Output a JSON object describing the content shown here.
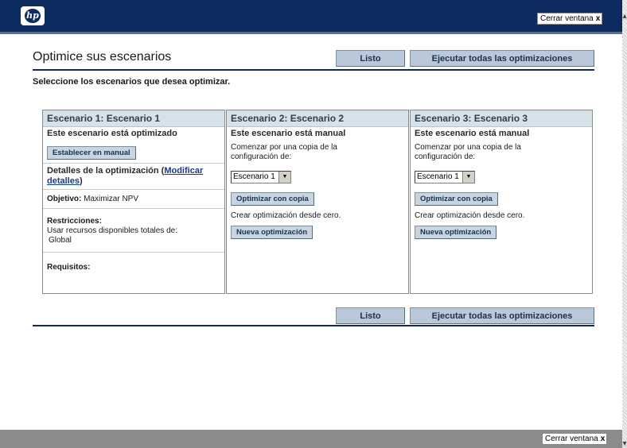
{
  "header": {
    "logo_text": "hp",
    "close_label": "Cerrar ventana",
    "close_icon": "x"
  },
  "page": {
    "title": "Optimice sus escenarios",
    "instruction": "Seleccione los escenarios que desea optimizar.",
    "done_label": "Listo",
    "run_all_label": "Ejecutar todas las optimizaciones"
  },
  "scenarios": [
    {
      "title": "Escenario 1: Escenario 1",
      "status": "Este escenario está optimizado",
      "set_manual_label": "Establecer en manual",
      "details_prefix": "Detalles de la optimización (",
      "details_link": "Modificar detalles",
      "details_suffix": ")",
      "objective_label": "Objetivo:",
      "objective_value": "Maximizar NPV",
      "restrictions_label": "Restricciones:",
      "restrictions_text": "Usar recursos disponibles totales de:",
      "restrictions_value": "Global",
      "requirements_label": "Requisitos:"
    },
    {
      "title": "Escenario 2: Escenario 2",
      "status": "Este escenario está manual",
      "copy_text": "Comenzar por una copia de la configuración de:",
      "select_value": "Escenario 1",
      "optimize_copy_label": "Optimizar con copia",
      "scratch_text": "Crear optimización desde cero.",
      "new_opt_label": "Nueva optimización"
    },
    {
      "title": "Escenario 3: Escenario 3",
      "status": "Este escenario está manual",
      "copy_text": "Comenzar por una copia de la configuración de:",
      "select_value": "Escenario 1",
      "optimize_copy_label": "Optimizar con copia",
      "scratch_text": "Crear optimización desde cero.",
      "new_opt_label": "Nueva optimización"
    }
  ],
  "footer": {
    "close_label": "Cerrar ventana",
    "close_icon": "x"
  },
  "colors": {
    "header_bg": "#0c2b5e",
    "button_bg": "#b9c9d9",
    "card_header_bg": "#d6e2ea",
    "footer_bg": "#8b8b8b"
  }
}
